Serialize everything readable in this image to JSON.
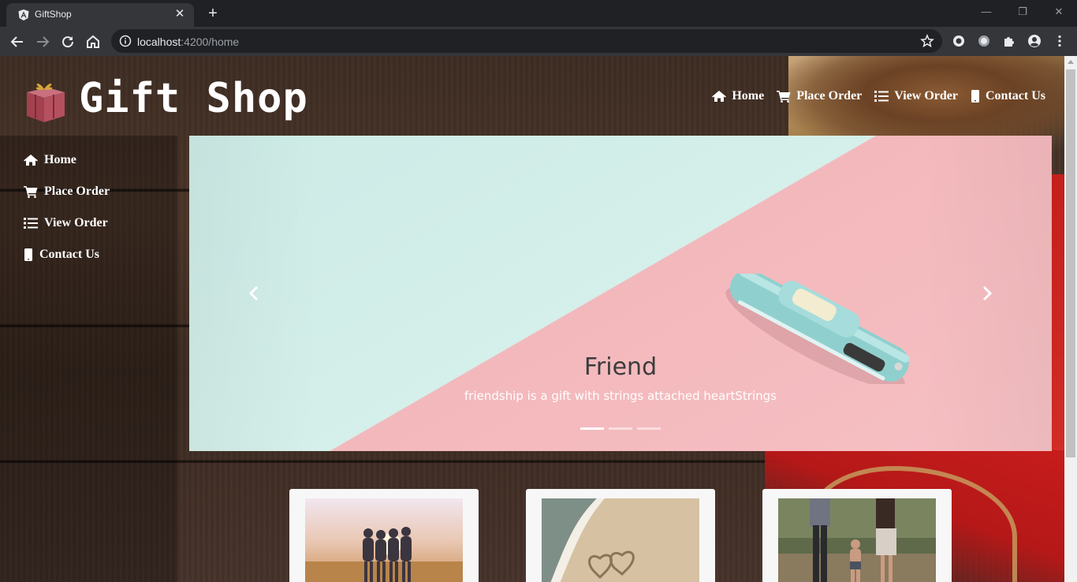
{
  "browser": {
    "tab_title": "GiftShop",
    "tab_close": "✕",
    "new_tab": "+",
    "url_host": "localhost",
    "url_rest": ":4200/home",
    "window_minimize": "—",
    "window_restore": "❐",
    "window_close": "✕"
  },
  "header": {
    "title": "Gift Shop"
  },
  "topnav": [
    {
      "label": "Home",
      "icon": "home-icon"
    },
    {
      "label": "Place Order",
      "icon": "cart-icon"
    },
    {
      "label": "View Order",
      "icon": "list-icon"
    },
    {
      "label": "Contact Us",
      "icon": "phone-icon"
    }
  ],
  "sidenav": [
    {
      "label": "Home",
      "icon": "home-icon"
    },
    {
      "label": "Place Order",
      "icon": "cart-icon"
    },
    {
      "label": "View Order",
      "icon": "list-icon"
    },
    {
      "label": "Contact Us",
      "icon": "phone-icon"
    }
  ],
  "carousel": {
    "caption_title": "Friend",
    "caption_text": "friendship is a gift with strings attached heartStrings",
    "slide_count": 3,
    "active_slide": 1
  },
  "cards": [
    {
      "image": "friends-sunset-photo"
    },
    {
      "image": "hearts-in-sand-photo"
    },
    {
      "image": "family-walk-photo"
    }
  ],
  "colors": {
    "chrome_dark": "#202124",
    "chrome_toolbar": "#35363a",
    "carousel_teal": "#d5efea",
    "carousel_pink": "#f6c0c3",
    "nav_text": "#ffffff"
  }
}
